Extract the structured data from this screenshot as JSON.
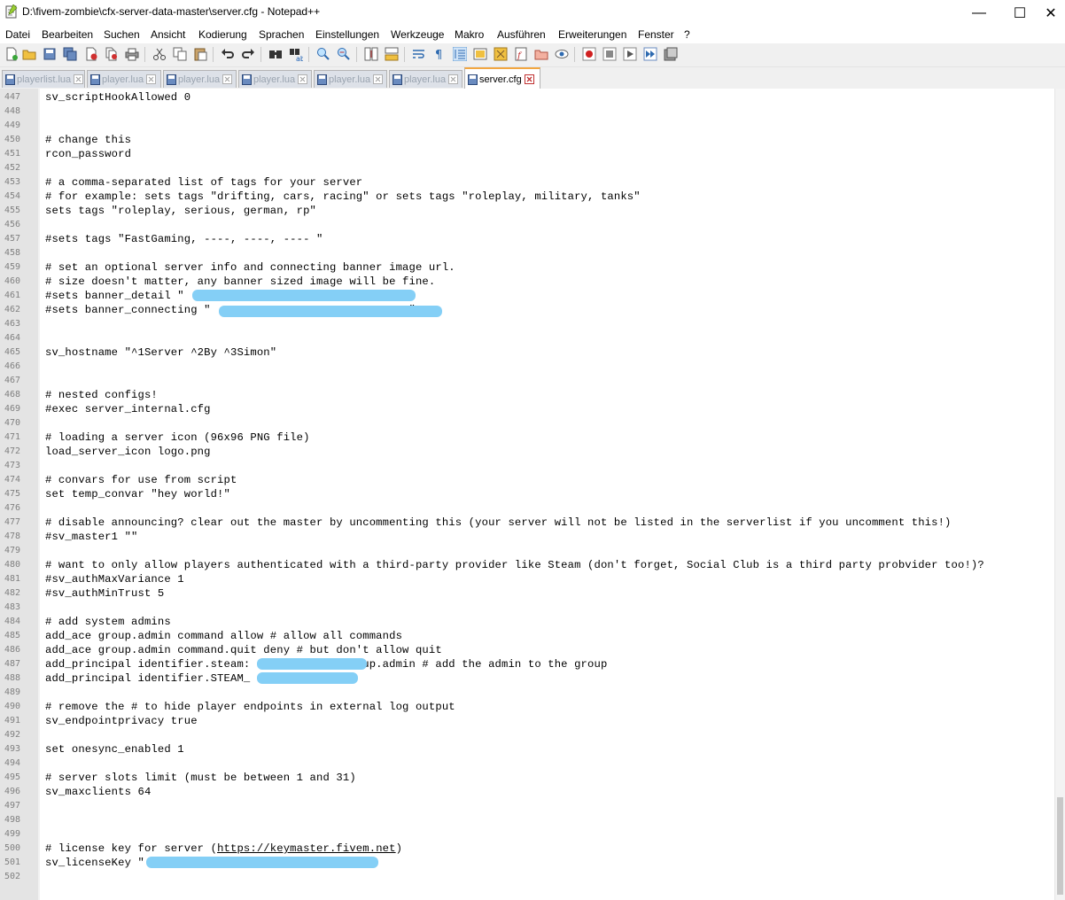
{
  "window": {
    "title": "D:\\fivem-zombie\\cfx-server-data-master\\server.cfg - Notepad++",
    "minimize_glyph": "—",
    "maximize_glyph": "☐",
    "close_glyph": "✕"
  },
  "menu": [
    "Datei",
    "Bearbeiten",
    "Suchen",
    "Ansicht",
    "Kodierung",
    "Sprachen",
    "Einstellungen",
    "Werkzeuge",
    "Makro",
    "Ausführen",
    "Erweiterungen",
    "Fenster",
    "?"
  ],
  "toolbar_icons": [
    "new-file-icon",
    "open-file-icon",
    "save-icon",
    "save-all-icon",
    "close-file-icon",
    "close-all-icon",
    "print-icon",
    "cut-icon",
    "copy-icon",
    "paste-icon",
    "undo-icon",
    "redo-icon",
    "find-icon",
    "replace-icon",
    "zoom-in-icon",
    "zoom-out-icon",
    "sync-vertical-icon",
    "sync-horizontal-icon",
    "word-wrap-icon",
    "show-all-chars-icon",
    "indent-guide-icon",
    "udl-icon",
    "doc-map-icon",
    "function-list-icon",
    "folder-workspace-icon",
    "monitoring-icon",
    "record-macro-icon",
    "stop-macro-icon",
    "play-macro-icon",
    "run-macro-multiple-icon",
    "save-macro-icon"
  ],
  "tabs": [
    {
      "label": "playerlist.lua",
      "active": false
    },
    {
      "label": "player.lua",
      "active": false
    },
    {
      "label": "player.lua",
      "active": false
    },
    {
      "label": "player.lua",
      "active": false
    },
    {
      "label": "player.lua",
      "active": false
    },
    {
      "label": "player.lua",
      "active": false
    },
    {
      "label": "server.cfg",
      "active": true
    }
  ],
  "editor": {
    "lines": [
      {
        "n": "447",
        "text": "sv_scriptHookAllowed 0"
      },
      {
        "n": "448",
        "text": ""
      },
      {
        "n": "449",
        "text": ""
      },
      {
        "n": "450",
        "text": "# change this"
      },
      {
        "n": "451",
        "text": "rcon_password"
      },
      {
        "n": "452",
        "text": ""
      },
      {
        "n": "453",
        "text": "# a comma-separated list of tags for your server"
      },
      {
        "n": "454",
        "text": "# for example: sets tags \"drifting, cars, racing\" or sets tags \"roleplay, military, tanks\""
      },
      {
        "n": "455",
        "text": "sets tags \"roleplay, serious, german, rp\""
      },
      {
        "n": "456",
        "text": ""
      },
      {
        "n": "457",
        "text": "#sets tags \"FastGaming, ----, ----, ---- \""
      },
      {
        "n": "458",
        "text": ""
      },
      {
        "n": "459",
        "text": "# set an optional server info and connecting banner image url."
      },
      {
        "n": "460",
        "text": "# size doesn't matter, any banner sized image will be fine."
      },
      {
        "n": "461",
        "text": "#sets banner_detail \"                              \""
      },
      {
        "n": "462",
        "text": "#sets banner_connecting \"                              \""
      },
      {
        "n": "463",
        "text": ""
      },
      {
        "n": "464",
        "text": ""
      },
      {
        "n": "465",
        "text": "sv_hostname \"^1Server ^2By ^3Simon\""
      },
      {
        "n": "466",
        "text": ""
      },
      {
        "n": "467",
        "text": ""
      },
      {
        "n": "468",
        "text": "# nested configs!"
      },
      {
        "n": "469",
        "text": "#exec server_internal.cfg"
      },
      {
        "n": "470",
        "text": ""
      },
      {
        "n": "471",
        "text": "# loading a server icon (96x96 PNG file)"
      },
      {
        "n": "472",
        "text": "load_server_icon logo.png"
      },
      {
        "n": "473",
        "text": ""
      },
      {
        "n": "474",
        "text": "# convars for use from script"
      },
      {
        "n": "475",
        "text": "set temp_convar \"hey world!\""
      },
      {
        "n": "476",
        "text": ""
      },
      {
        "n": "477",
        "text": "# disable announcing? clear out the master by uncommenting this (your server will not be listed in the serverlist if you uncomment this!)"
      },
      {
        "n": "478",
        "text": "#sv_master1 \"\""
      },
      {
        "n": "479",
        "text": ""
      },
      {
        "n": "480",
        "text": "# want to only allow players authenticated with a third-party provider like Steam (don't forget, Social Club is a third party probvider too!)?"
      },
      {
        "n": "481",
        "text": "#sv_authMaxVariance 1"
      },
      {
        "n": "482",
        "text": "#sv_authMinTrust 5"
      },
      {
        "n": "483",
        "text": ""
      },
      {
        "n": "484",
        "text": "# add system admins"
      },
      {
        "n": "485",
        "text": "add_ace group.admin command allow # allow all commands"
      },
      {
        "n": "486",
        "text": "add_ace group.admin command.quit deny # but don't allow quit"
      },
      {
        "n": "487",
        "text": "add_principal identifier.steam:              group.admin # add the admin to the group"
      },
      {
        "n": "488",
        "text": "add_principal identifier.STEAM_"
      },
      {
        "n": "489",
        "text": ""
      },
      {
        "n": "490",
        "text": "# remove the # to hide player endpoints in external log output"
      },
      {
        "n": "491",
        "text": "sv_endpointprivacy true"
      },
      {
        "n": "492",
        "text": ""
      },
      {
        "n": "493",
        "text": "set onesync_enabled 1"
      },
      {
        "n": "494",
        "text": ""
      },
      {
        "n": "495",
        "text": "# server slots limit (must be between 1 and 31)"
      },
      {
        "n": "496",
        "text": "sv_maxclients 64"
      },
      {
        "n": "497",
        "text": ""
      },
      {
        "n": "498",
        "text": ""
      },
      {
        "n": "499",
        "text": ""
      },
      {
        "n": "500",
        "text": "# license key for server (https://keymaster.fivem.net)"
      },
      {
        "n": "501",
        "text": "sv_licenseKey \"                             \""
      },
      {
        "n": "502",
        "text": ""
      }
    ]
  },
  "colors": {
    "gutter_bg": "#e4e4e4",
    "line_number": "#808080",
    "redaction": "#84cff6",
    "active_tab_accent": "#f2a640"
  }
}
